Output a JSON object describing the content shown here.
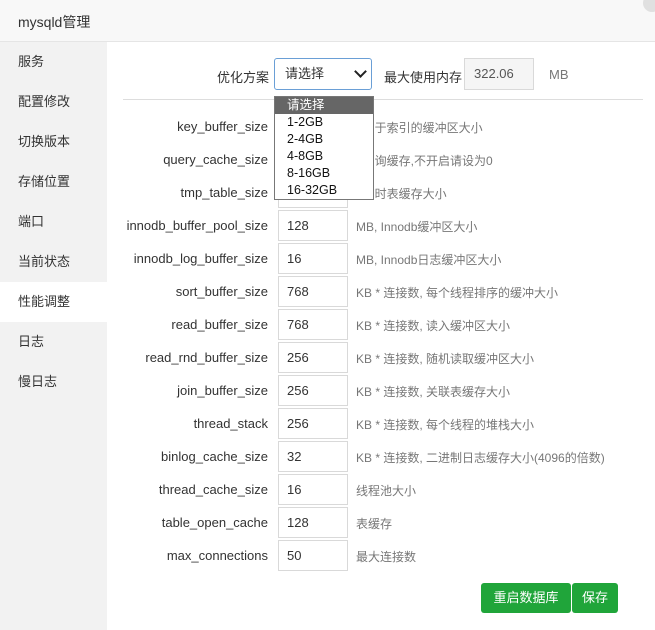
{
  "window": {
    "title": "mysqld管理"
  },
  "sidebar": {
    "items": [
      {
        "label": "服务"
      },
      {
        "label": "配置修改"
      },
      {
        "label": "切换版本"
      },
      {
        "label": "存储位置"
      },
      {
        "label": "端口"
      },
      {
        "label": "当前状态"
      },
      {
        "label": "性能调整"
      },
      {
        "label": "日志"
      },
      {
        "label": "慢日志"
      }
    ],
    "active": "性能调整"
  },
  "optimize": {
    "label": "优化方案",
    "selected": "请选择",
    "options": [
      "请选择",
      "1-2GB",
      "2-4GB",
      "4-8GB",
      "8-16GB",
      "16-32GB"
    ]
  },
  "max_memory": {
    "label": "最大使用内存",
    "value": "322.06",
    "unit": "MB"
  },
  "params": [
    {
      "name": "key_buffer_size",
      "value": "",
      "desc": ", 用于索引的缓冲区大小"
    },
    {
      "name": "query_cache_size",
      "value": "",
      "desc": ", 查询缓存,不开启请设为0"
    },
    {
      "name": "tmp_table_size",
      "value": "",
      "desc": ", 临时表缓存大小"
    },
    {
      "name": "innodb_buffer_pool_size",
      "value": "128",
      "desc": "MB, Innodb缓冲区大小"
    },
    {
      "name": "innodb_log_buffer_size",
      "value": "16",
      "desc": "MB, Innodb日志缓冲区大小"
    },
    {
      "name": "sort_buffer_size",
      "value": "768",
      "desc": "KB * 连接数, 每个线程排序的缓冲大小"
    },
    {
      "name": "read_buffer_size",
      "value": "768",
      "desc": "KB * 连接数, 读入缓冲区大小"
    },
    {
      "name": "read_rnd_buffer_size",
      "value": "256",
      "desc": "KB * 连接数, 随机读取缓冲区大小"
    },
    {
      "name": "join_buffer_size",
      "value": "256",
      "desc": "KB * 连接数, 关联表缓存大小"
    },
    {
      "name": "thread_stack",
      "value": "256",
      "desc": "KB * 连接数, 每个线程的堆栈大小"
    },
    {
      "name": "binlog_cache_size",
      "value": "32",
      "desc": "KB * 连接数, 二进制日志缓存大小(4096的倍数)"
    },
    {
      "name": "thread_cache_size",
      "value": "16",
      "desc": "线程池大小"
    },
    {
      "name": "table_open_cache",
      "value": "128",
      "desc": "表缓存"
    },
    {
      "name": "max_connections",
      "value": "50",
      "desc": "最大连接数"
    }
  ],
  "buttons": {
    "restart": "重启数据库",
    "save": "保存"
  },
  "colors": {
    "accent": "#20a53a",
    "sidebar_bg": "#f2f2f2"
  }
}
